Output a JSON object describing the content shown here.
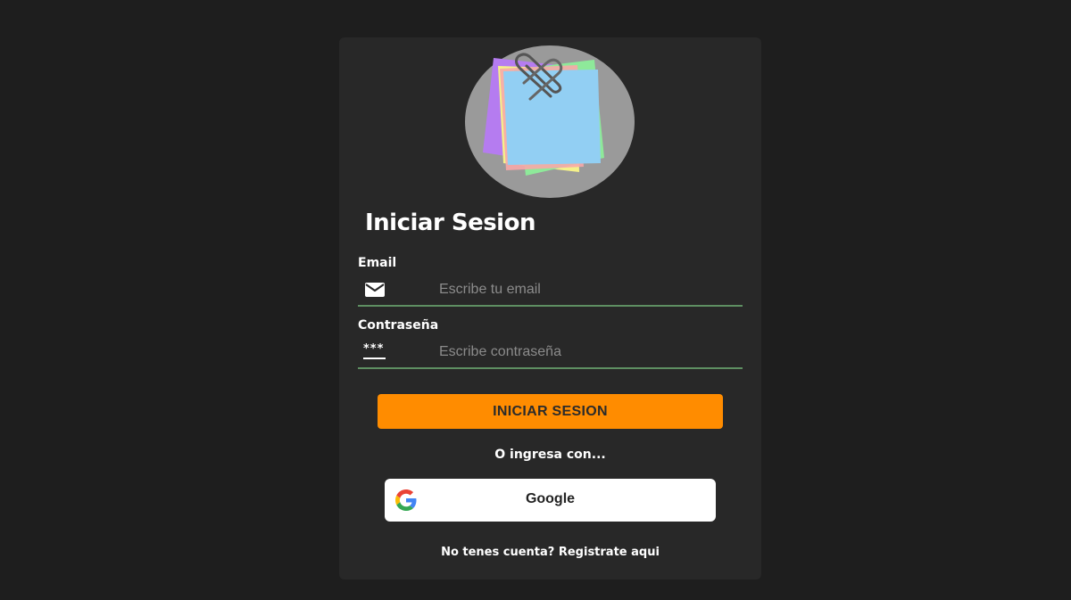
{
  "login": {
    "title": "Iniciar Sesion",
    "email": {
      "label": "Email",
      "placeholder": "Escribe tu email",
      "value": "",
      "icon": "envelope-icon"
    },
    "password": {
      "label": "Contraseña",
      "placeholder": "Escribe contraseña",
      "value": "",
      "icon": "password-asterisks-icon",
      "icon_glyph": "***"
    },
    "submit_label": "INICIAR SESION",
    "alt_text": "O ingresa con...",
    "google_label": "Google",
    "footer_text": "No tenes cuenta? ",
    "footer_link": "Registrate aqui"
  },
  "colors": {
    "background": "#1e1e1e",
    "card": "#282828",
    "accent": "#ff8c00",
    "field_underline": "#5e8f62",
    "logo_circle": "#9a9a9a"
  },
  "logo_icon": "sticky-notes-paperclip-icon"
}
